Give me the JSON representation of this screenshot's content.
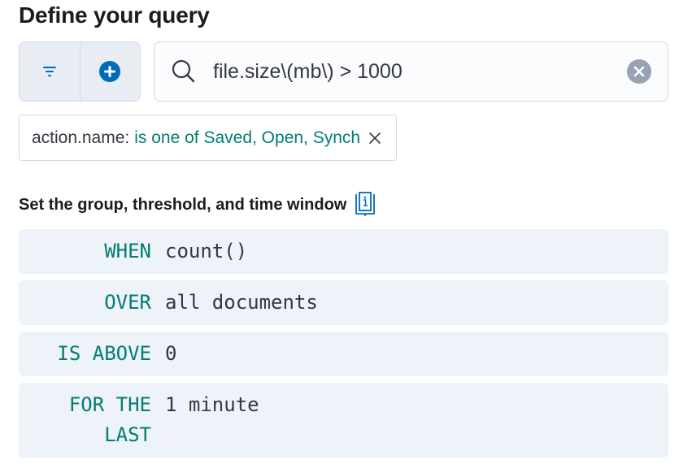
{
  "title": "Define your query",
  "toolbar": {
    "filter_icon": "filter-icon",
    "add_icon": "plus-circle-icon"
  },
  "search": {
    "value": "file.size\\(mb\\) > 1000",
    "search_icon": "search-icon",
    "clear_icon": "clear-icon"
  },
  "filter_pill": {
    "key": "action.name:",
    "value": "is one of Saved, Open, Synch",
    "remove_icon": "close-icon"
  },
  "section": {
    "title": "Set the group, threshold, and time window",
    "doc_icon": "documentation-icon"
  },
  "expressions": {
    "when": {
      "keyword": "WHEN",
      "value": "count()"
    },
    "over": {
      "keyword": "OVER",
      "value": "all documents"
    },
    "threshold": {
      "keyword": "IS ABOVE",
      "value": "0"
    },
    "window": {
      "keyword_line1": "FOR THE",
      "keyword_line2": "LAST",
      "value": "1 minute"
    }
  },
  "colors": {
    "accent": "#006bb8",
    "keyword": "#017d73",
    "expression_bg": "#eef2f9",
    "border": "#d3dae6"
  }
}
